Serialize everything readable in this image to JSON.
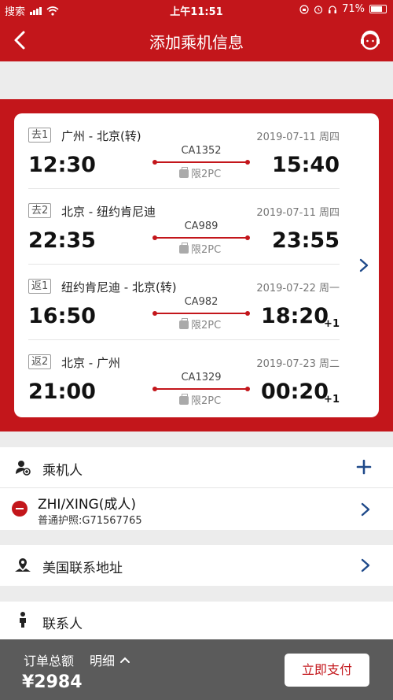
{
  "status_bar": {
    "carrier": "搜索",
    "time": "上午11:51",
    "battery": "71%"
  },
  "nav": {
    "title": "添加乘机信息",
    "back_icon": "chevron-left-icon",
    "service_icon": "customer-service-icon"
  },
  "segments": [
    {
      "tag": "去1",
      "route": "广州 - 北京(转)",
      "date": "2019-07-11 周四",
      "dep": "12:30",
      "flight": "CA1352",
      "baggage": "限2PC",
      "arr": "15:40",
      "next_day": ""
    },
    {
      "tag": "去2",
      "route": "北京 - 纽约肯尼迪",
      "date": "2019-07-11 周四",
      "dep": "22:35",
      "flight": "CA989",
      "baggage": "限2PC",
      "arr": "23:55",
      "next_day": ""
    },
    {
      "tag": "返1",
      "route": "纽约肯尼迪 - 北京(转)",
      "date": "2019-07-22 周一",
      "dep": "16:50",
      "flight": "CA982",
      "baggage": "限2PC",
      "arr": "18:20",
      "next_day": "+1"
    },
    {
      "tag": "返2",
      "route": "北京 - 广州",
      "date": "2019-07-23 周二",
      "dep": "21:00",
      "flight": "CA1329",
      "baggage": "限2PC",
      "arr": "00:20",
      "next_day": "+1"
    }
  ],
  "passengers": {
    "title": "乘机人",
    "list": [
      {
        "name": "ZHI/XING(成人)",
        "doc": "普通护照:G71567765"
      }
    ]
  },
  "us_address": {
    "title": "美国联系地址"
  },
  "contact": {
    "title": "联系人"
  },
  "footer": {
    "label": "订单总额",
    "detail": "明细",
    "total": "¥2984",
    "pay": "立即支付"
  },
  "colors": {
    "brand_red": "#c3161b",
    "footer_gray": "#5b5b5b"
  }
}
